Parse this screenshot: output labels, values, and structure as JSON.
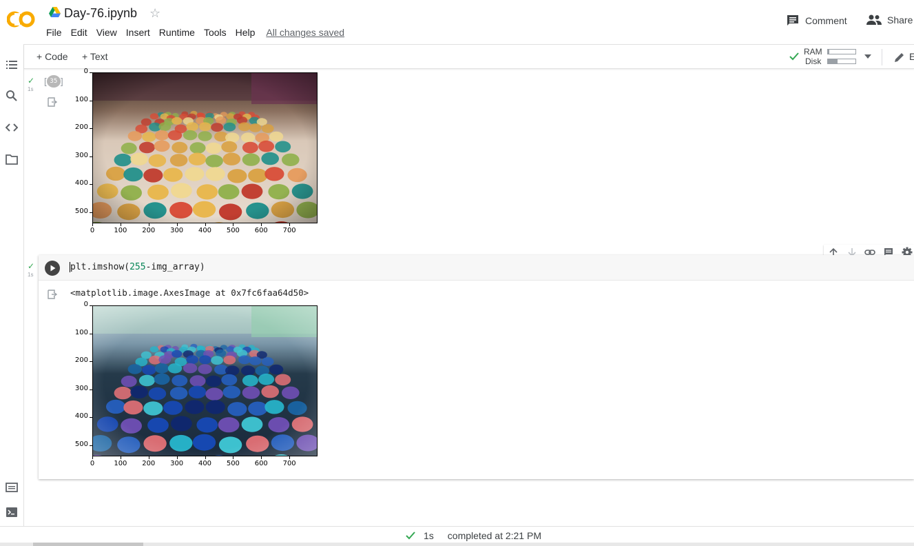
{
  "header": {
    "logo_text": "CO",
    "title": "Day-76.ipynb",
    "menu": [
      "File",
      "Edit",
      "View",
      "Insert",
      "Runtime",
      "Tools",
      "Help"
    ],
    "saved_status": "All changes saved",
    "comment_label": "Comment",
    "share_label": "Share"
  },
  "toolbar": {
    "add_code_label": "+ Code",
    "add_text_label": "+ Text",
    "ram_label": "RAM",
    "disk_label": "Disk",
    "ram_usage": 0.05,
    "disk_usage": 0.35,
    "edit_label_partial": "E"
  },
  "cells": [
    {
      "exec_count": "[35]",
      "duration": "1s",
      "plot": {
        "image": "macarons-original",
        "y_ticks": [
          "0",
          "100",
          "200",
          "300",
          "400",
          "500"
        ],
        "x_ticks": [
          "0",
          "100",
          "200",
          "300",
          "400",
          "500",
          "600",
          "700"
        ]
      }
    },
    {
      "duration": "1s",
      "code": "plt.imshow(255-img_array)",
      "code_parts": {
        "fn": "plt.imshow(",
        "num": "255",
        "rest": "-img_array)"
      },
      "output_text": "<matplotlib.image.AxesImage at 0x7fc6faa64d50>",
      "plot": {
        "image": "macarons-inverted",
        "y_ticks": [
          "0",
          "100",
          "200",
          "300",
          "400",
          "500"
        ],
        "x_ticks": [
          "0",
          "100",
          "200",
          "300",
          "400",
          "500",
          "600",
          "700"
        ]
      }
    }
  ],
  "statusbar": {
    "duration": "1s",
    "message": "completed at 2:21 PM"
  },
  "colors": {
    "accent_orange": "#f9ab00",
    "success_green": "#34a853",
    "code_number": "#098658"
  }
}
